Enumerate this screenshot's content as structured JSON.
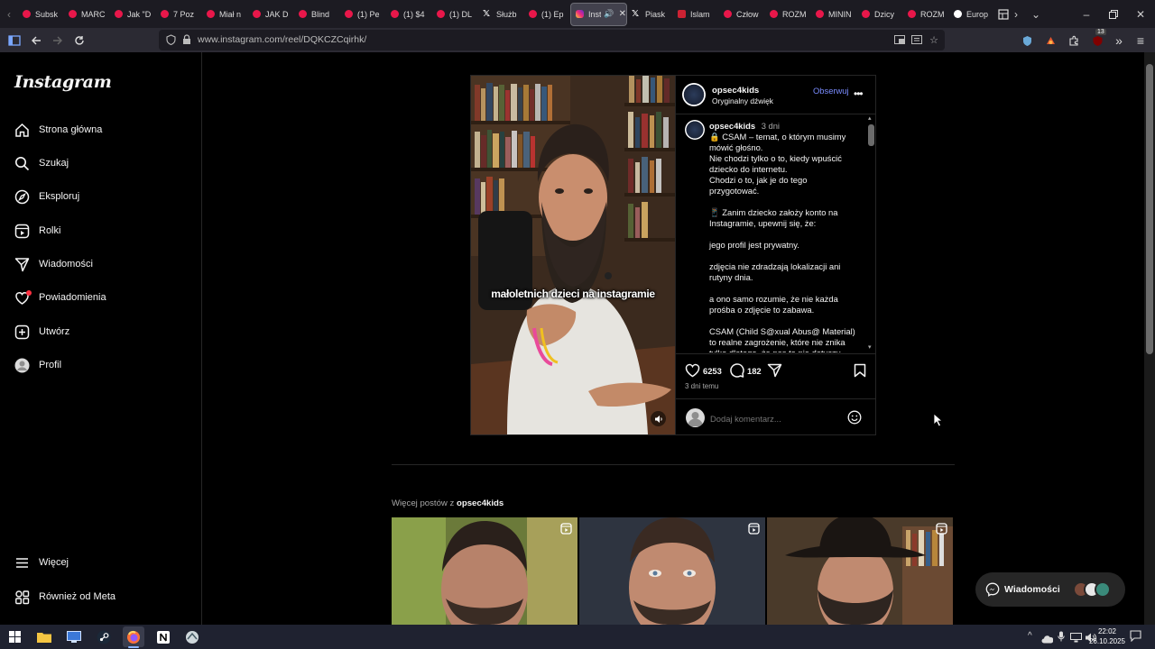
{
  "browser": {
    "tabs": [
      {
        "label": "Subsk",
        "icon": "youtube-icon"
      },
      {
        "label": "MARC",
        "icon": "youtube-icon"
      },
      {
        "label": "Jak \"D",
        "icon": "youtube-icon"
      },
      {
        "label": "7 Poz",
        "icon": "youtube-icon"
      },
      {
        "label": "Miał n",
        "icon": "youtube-icon"
      },
      {
        "label": "JAK D",
        "icon": "youtube-icon"
      },
      {
        "label": "Blind",
        "icon": "youtube-icon"
      },
      {
        "label": "(1) Pe",
        "icon": "youtube-icon"
      },
      {
        "label": "(1) $4",
        "icon": "youtube-icon"
      },
      {
        "label": "(1) DL",
        "icon": "youtube-icon"
      },
      {
        "label": "Służb",
        "icon": "x-icon"
      },
      {
        "label": "(1) Ep",
        "icon": "youtube-icon"
      },
      {
        "label": "Inst",
        "icon": "instagram-icon",
        "active": true
      },
      {
        "label": "Piask",
        "icon": "x-icon"
      },
      {
        "label": "Islam",
        "icon": "flag-icon"
      },
      {
        "label": "Człow",
        "icon": "youtube-icon"
      },
      {
        "label": "ROZM",
        "icon": "youtube-icon"
      },
      {
        "label": "MININ",
        "icon": "youtube-icon"
      },
      {
        "label": "Dzicy",
        "icon": "youtube-icon"
      },
      {
        "label": "ROZM",
        "icon": "youtube-icon"
      },
      {
        "label": "Europ",
        "icon": "wikipedia-icon"
      }
    ],
    "url": "www.instagram.com/reel/DQKCZCqirhk/",
    "extension_badge": "13"
  },
  "sidebar": {
    "logo": "Instagram",
    "items": [
      {
        "label": "Strona główna",
        "icon": "home-icon"
      },
      {
        "label": "Szukaj",
        "icon": "search-icon"
      },
      {
        "label": "Eksploruj",
        "icon": "compass-icon"
      },
      {
        "label": "Rolki",
        "icon": "reels-icon"
      },
      {
        "label": "Wiadomości",
        "icon": "messenger-icon"
      },
      {
        "label": "Powiadomienia",
        "icon": "heart-icon"
      },
      {
        "label": "Utwórz",
        "icon": "plus-square-icon"
      },
      {
        "label": "Profil",
        "icon": "avatar-icon"
      }
    ],
    "bottom_items": [
      {
        "label": "Więcej",
        "icon": "menu-icon"
      },
      {
        "label": "Również od Meta",
        "icon": "meta-grid-icon"
      }
    ]
  },
  "post": {
    "video_subtitle": "małoletnich dzieci na instagramie",
    "author": "opsec4kids",
    "audio": "Oryginalny dźwięk",
    "follow_label": "Obserwuj",
    "caption_author": "opsec4kids",
    "caption_age": "3 dni",
    "caption_lines": [
      "🔒 CSAM – temat, o którym musimy",
      "mówić głośno.",
      "Nie chodzi tylko o to, kiedy wpuścić",
      "dziecko do internetu.",
      "Chodzi o to, jak je do tego",
      "przygotować.",
      "",
      "📱 Zanim dziecko założy konto na",
      "Instagramie, upewnij się, że:",
      "",
      "jego profil jest prywatny.",
      "",
      "zdjęcia nie zdradzają lokalizacji ani",
      "rutyny dnia.",
      "",
      "a ono samo rozumie, że nie każda",
      "prośba o zdjęcie to zabawa.",
      "",
      "CSAM (Child S@xual Abus@ Material)",
      "to realne zagrożenie, które nie znika",
      "tylko dlatego, że nas to nie dotyczy."
    ],
    "likes": "6253",
    "comments": "182",
    "posted_ago": "3 dni temu",
    "comment_placeholder": "Dodaj komentarz..."
  },
  "more_posts": {
    "label_prefix": "Więcej postów z",
    "label_user": "opsec4kids"
  },
  "messages_pill": {
    "label": "Wiadomości"
  },
  "taskbar": {
    "time": "22:02",
    "date": "26.10.2025"
  },
  "colors": {
    "background": "#000000",
    "link_blue": "#7a8cff",
    "text": "#f5f5f5",
    "muted": "#a8a8a8"
  }
}
